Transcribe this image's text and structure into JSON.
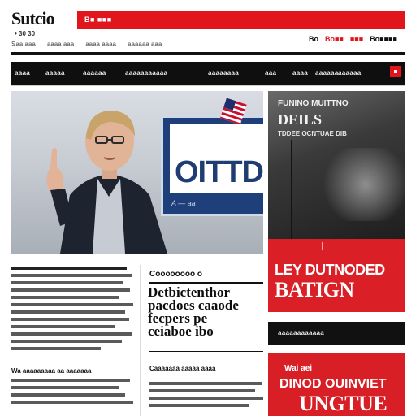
{
  "masthead": {
    "logo": "Sutcio",
    "subline": "• 30 30",
    "top_bar_label": "B■ ■■■",
    "edition_links": [
      "Saa aaa",
      "aaaa aaa",
      "aaaa aaaa",
      "aaaaaa aaa"
    ],
    "topright": [
      {
        "text": "Bo",
        "red": false
      },
      {
        "text": "Bo■■",
        "red": true
      },
      {
        "text": "■■■",
        "red": true
      },
      {
        "text": "Bo■■■■",
        "red": false
      }
    ]
  },
  "nav": {
    "items_left": [
      "aaaa",
      "aaaaa",
      "aaaaaa",
      "aaaaaaaaaaa"
    ],
    "items_right": [
      "aaaaaaaa",
      "aaa",
      "aaaa",
      "aaaaaa",
      "aaaaaa"
    ]
  },
  "hero": {
    "screen_word": "OITTD",
    "screen_foot": "A — aa"
  },
  "lead_story": {
    "byline": "Wa aaaaaaaaa aa aaaaaaa"
  },
  "feature": {
    "kicker": "Coooooooo o",
    "headline_lines": [
      "Detbictenthor",
      "pacdoes caaode",
      "fecpers pe",
      "ceiaboe ibo"
    ],
    "sub": "Caaaaaaa aaaaa aaaa"
  },
  "side1": {
    "kicker": "FUNINO MUITTNO",
    "title": "DEILS",
    "sub": "TDDEE OCNTUAE DIB"
  },
  "side2": {
    "headline_1": "LEY DUTNODED",
    "headline_2": "BATIGN"
  },
  "side3": {
    "label": "aaaaaaaaaaaa"
  },
  "side4": {
    "kicker": "Wai aei",
    "line_1": "DINOD OUINVIET",
    "line_2": "UNGTUE"
  },
  "colors": {
    "accent": "#e0161c",
    "nav_bg": "#0f0f0f",
    "screen_blue": "#1e3f7a"
  }
}
